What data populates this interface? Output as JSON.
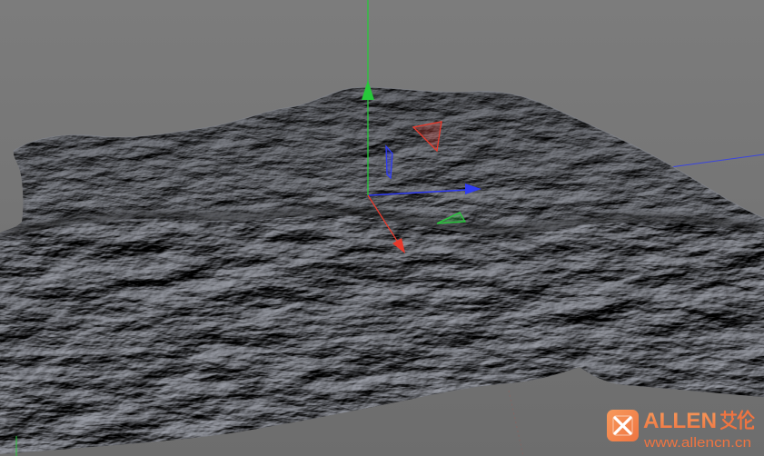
{
  "viewport": {
    "bg_top": "#7c7c7c",
    "bg_bottom": "#6d6d6d",
    "terrain_far_light": "#8e9199",
    "terrain_near_light": "#9ea1aa",
    "terrain_rim": "#858891"
  },
  "gizmo": {
    "x_axis_color": "#e8392b",
    "y_axis_color": "#27c93a",
    "z_axis_color": "#2f3cf2",
    "move_icon": "axis-arrows-icon",
    "rotate_icon": "rotation-band-icon"
  },
  "watermark": {
    "brand": "ALLEN",
    "brand_cn": "艾伦",
    "url": "www.allencn.cn",
    "accent": "#ef7441",
    "accent_light": "#f79a5c",
    "icon": "cross-x-icon"
  }
}
